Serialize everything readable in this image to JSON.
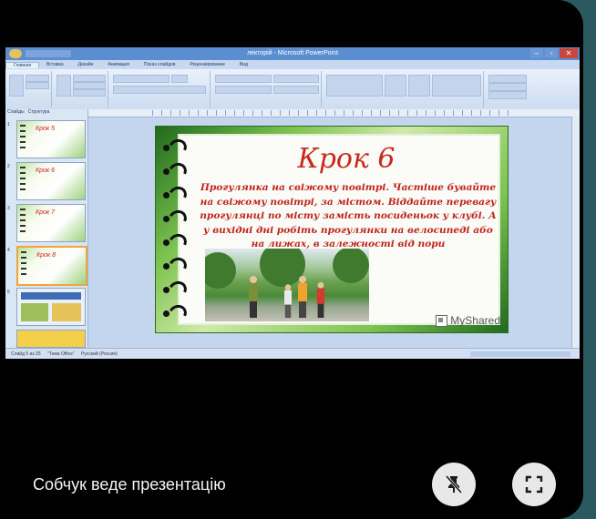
{
  "app": {
    "window_title": "лекторій - Microsoft PowerPoint",
    "ribbon_tabs": [
      "Главная",
      "Вставка",
      "Дизайн",
      "Анимация",
      "Показ слайдов",
      "Рецензирование",
      "Вид"
    ],
    "pane_tabs": [
      "Слайды",
      "Структура"
    ],
    "status_left": "Слайд 5 из 25",
    "status_theme": "\"Тема Office\"",
    "status_lang": "Русский (Россия)"
  },
  "slide": {
    "title": "Крок 6",
    "text": "Прогулянка на свіжому повітрі. Частіше бувайте на свіжому повітрі, за містом. Віддайте перевагу прогулянці по місту замість посиденьок у клубі. А у вихідні дні робіть прогулянки на велосипеді або на лижах, в залежності від пори",
    "watermark": "MyShared"
  },
  "thumbnails": [
    {
      "num": "1",
      "title": "Крок 5"
    },
    {
      "num": "2",
      "title": "Крок 6"
    },
    {
      "num": "3",
      "title": "Крок 7"
    },
    {
      "num": "4",
      "title": "Крок 8"
    },
    {
      "num": "5",
      "title": ""
    }
  ],
  "meeting": {
    "presenter_caption": "Собчук веде презентацію",
    "unpin_icon": "unpin-icon",
    "fullscreen_icon": "fullscreen-icon"
  },
  "colors": {
    "title_red": "#c9281e",
    "frame_green": "#3d8f2f",
    "meeting_bg": "#000000",
    "accent_teal": "#2a5a60"
  }
}
